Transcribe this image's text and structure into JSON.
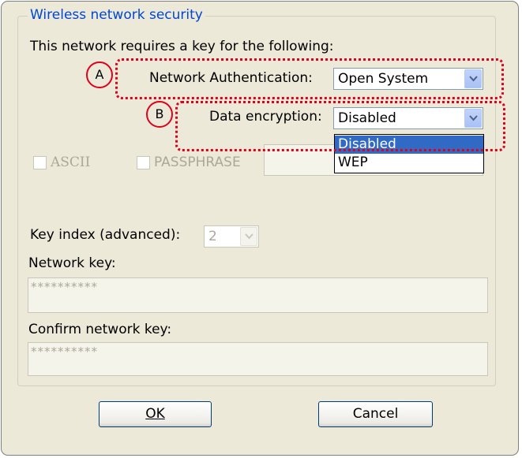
{
  "group": {
    "title": "Wireless network security"
  },
  "intro_text": "This network requires a key for the following:",
  "network_auth": {
    "label": "Network Authentication:",
    "value": "Open System"
  },
  "data_encryption": {
    "label": "Data encryption:",
    "value": "Disabled",
    "options": [
      "Disabled",
      "WEP"
    ],
    "highlighted_option": "Disabled"
  },
  "key_format": {
    "ascii_label": "ASCII",
    "passphrase_label": "PASSPHRASE"
  },
  "key_index": {
    "label": "Key index (advanced):",
    "value": "2"
  },
  "network_key": {
    "label": "Network key:",
    "value": "**********"
  },
  "confirm_key": {
    "label": "Confirm network key:",
    "value": "**********"
  },
  "buttons": {
    "ok": "OK",
    "cancel": "Cancel"
  },
  "annotations": {
    "a": "A",
    "b": "B",
    "color": "#e0001b"
  },
  "colors": {
    "selection": "#316ac5",
    "group_title": "#0046d5",
    "dialog_bg": "#ece9d8"
  }
}
